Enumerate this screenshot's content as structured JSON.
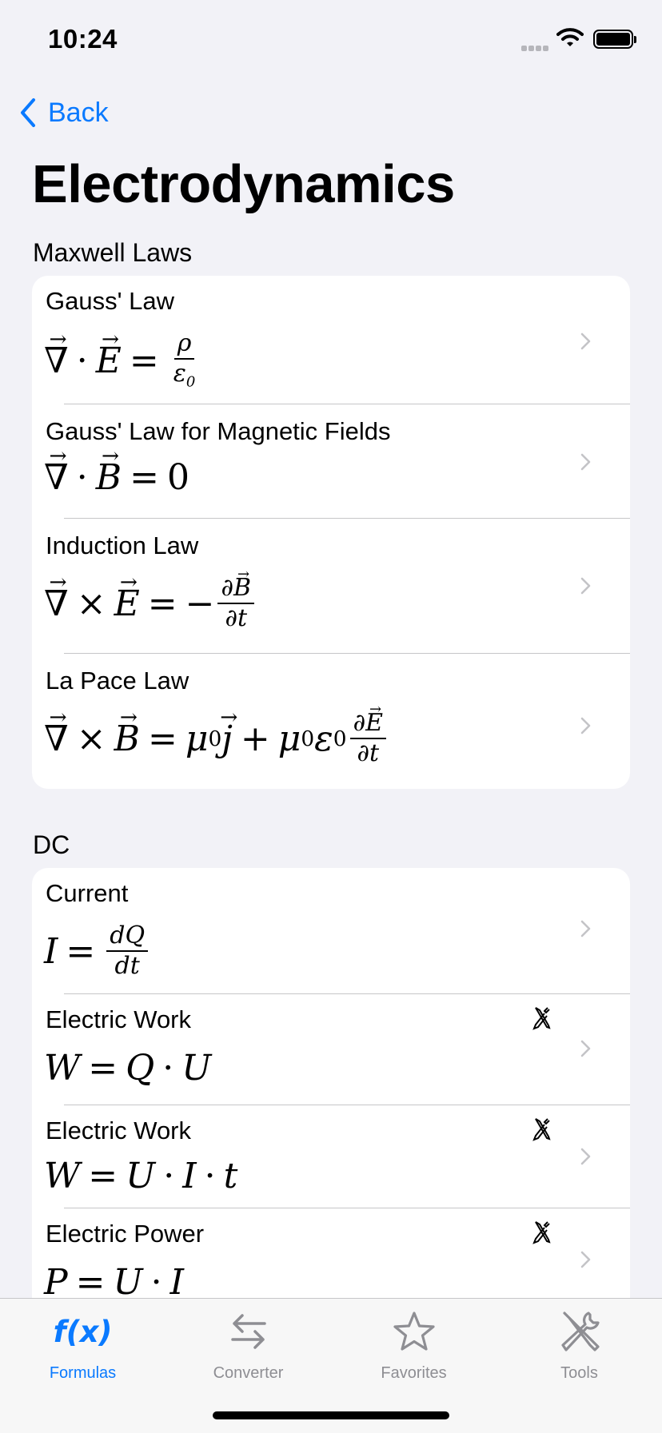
{
  "status_bar": {
    "time": "10:24"
  },
  "nav": {
    "back_label": "Back",
    "title": "Electrodynamics"
  },
  "sections": [
    {
      "header": "Maxwell Laws",
      "rows": [
        {
          "name": "Gauss' Law",
          "formula": "∇·E = ρ/ε₀",
          "tool": false
        },
        {
          "name": "Gauss' Law for Magnetic Fields",
          "formula": "∇·B = 0",
          "tool": false
        },
        {
          "name": "Induction Law",
          "formula": "∇×E = −∂B/∂t",
          "tool": false
        },
        {
          "name": "La Pace Law",
          "formula": "∇×B = μ₀j + μ₀ε₀ ∂E/∂t",
          "tool": false
        }
      ]
    },
    {
      "header": "DC",
      "rows": [
        {
          "name": "Current",
          "formula": "I = dQ/dt",
          "tool": false
        },
        {
          "name": "Electric Work",
          "formula": "W = Q·U",
          "tool": true
        },
        {
          "name": "Electric Work",
          "formula": "W = U·I·t",
          "tool": true
        },
        {
          "name": "Electric Power",
          "formula": "P = U·I",
          "tool": true
        }
      ]
    }
  ],
  "tabbar": {
    "tabs": [
      {
        "label": "Formulas",
        "icon": "fx-icon",
        "active": true
      },
      {
        "label": "Converter",
        "icon": "arrows-left-right-icon",
        "active": false
      },
      {
        "label": "Favorites",
        "icon": "star-icon",
        "active": false
      },
      {
        "label": "Tools",
        "icon": "wrench-screwdriver-icon",
        "active": false
      }
    ],
    "formulas_icon_text": "f(x)"
  },
  "colors": {
    "accent": "#0a7aff",
    "background": "#f2f2f7",
    "card": "#ffffff",
    "inactive": "#8e8e93"
  }
}
